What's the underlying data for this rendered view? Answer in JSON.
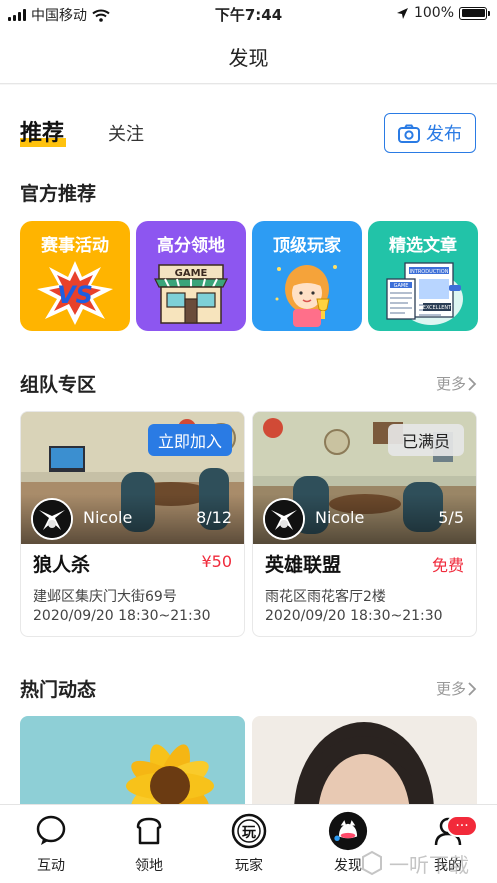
{
  "status_bar": {
    "carrier": "中国移动",
    "time": "下午7:44",
    "battery": "100%",
    "icons": [
      "signal-icon",
      "wifi-icon",
      "location-arrow-icon",
      "battery-icon"
    ]
  },
  "nav": {
    "title": "发现"
  },
  "tabs": {
    "active": "推荐",
    "other": "关注"
  },
  "publish": {
    "label": "发布",
    "icon": "camera-icon"
  },
  "official": {
    "title": "官方推荐",
    "cards": [
      {
        "label": "赛事活动",
        "color": "#ffb400",
        "art_text": "VS"
      },
      {
        "label": "高分领地",
        "color": "#8d56f0",
        "art_text": "GAME"
      },
      {
        "label": "顶级玩家",
        "color": "#2d9cf3"
      },
      {
        "label": "精选文章",
        "color": "#22c3a8",
        "art_text": [
          "INTRODUCTION",
          "GAME",
          "EXCELLENT"
        ]
      }
    ]
  },
  "teams": {
    "title": "组队专区",
    "more": "更多",
    "items": [
      {
        "badge": "立即加入",
        "host": "Nicole",
        "count": "8/12",
        "name": "狼人杀",
        "price": "¥50",
        "address": "建邺区集庆门大街69号",
        "time": "2020/09/20  18:30~21:30"
      },
      {
        "badge": "已满员",
        "host": "Nicole",
        "count": "5/5",
        "name": "英雄联盟",
        "price": "免费",
        "address": "雨花区雨花客厅2楼",
        "time": "2020/09/20  18:30~21:30"
      }
    ]
  },
  "hot": {
    "title": "热门动态",
    "more": "更多"
  },
  "tab_bar": {
    "items": [
      {
        "label": "互动",
        "icon": "chat-bubble-icon"
      },
      {
        "label": "领地",
        "icon": "bread-icon"
      },
      {
        "label": "玩家",
        "icon": "play-badge-icon",
        "badge_text": "玩"
      },
      {
        "label": "发现",
        "icon": "discover-icon",
        "active": true
      },
      {
        "label": "我的",
        "icon": "profile-icon",
        "badge": "···"
      }
    ]
  },
  "watermark": {
    "text": "一听下载"
  }
}
